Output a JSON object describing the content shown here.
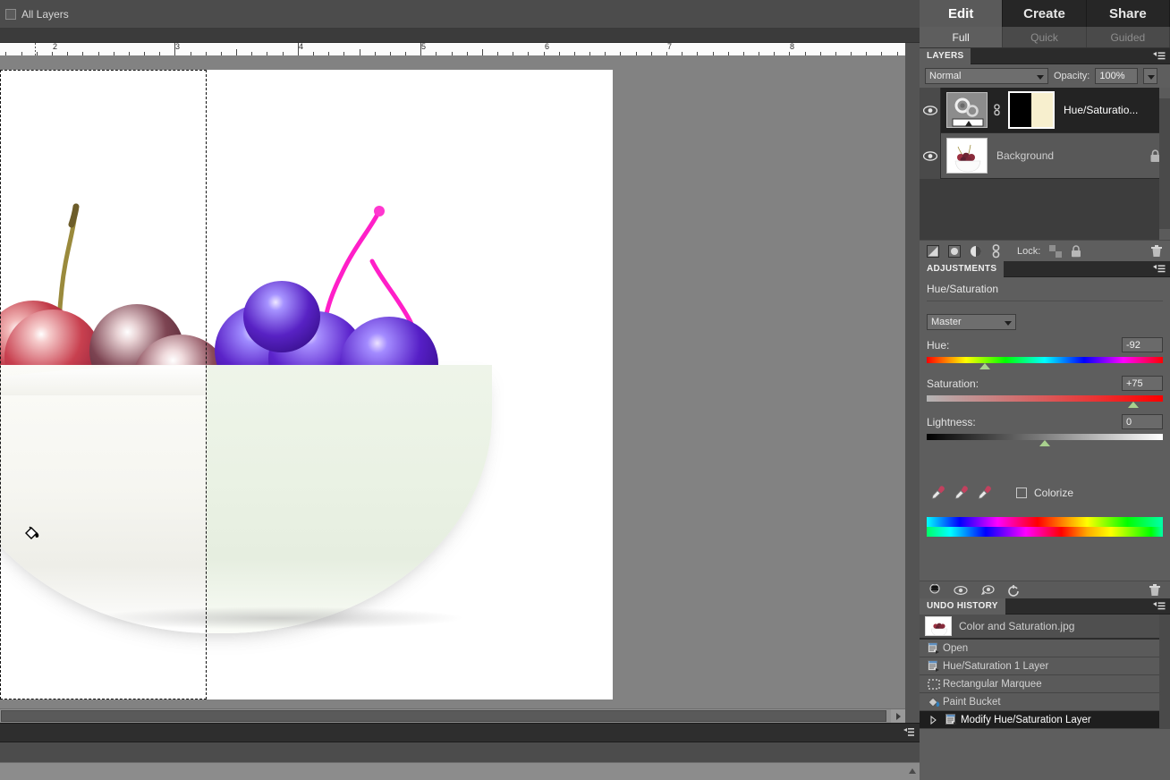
{
  "options_bar": {
    "all_layers_label": "All Layers",
    "all_layers_checked": false
  },
  "ruler": {
    "unit_marks": [
      "2",
      "3",
      "4",
      "5",
      "6",
      "7",
      "8"
    ]
  },
  "canvas": {
    "cursor_icon": "paint-bucket-cursor",
    "selection": "rectangular-marquee",
    "description_left": "original red cherries in white bowl",
    "description_right": "hue-shifted purple cherries"
  },
  "right_panel": {
    "main_tabs": [
      {
        "label": "Edit",
        "active": true
      },
      {
        "label": "Create",
        "active": false
      },
      {
        "label": "Share",
        "active": false
      }
    ],
    "sub_tabs": [
      {
        "label": "Full",
        "active": true
      },
      {
        "label": "Quick",
        "active": false
      },
      {
        "label": "Guided",
        "active": false
      }
    ]
  },
  "layers_panel": {
    "title": "LAYERS",
    "blend_mode": "Normal",
    "opacity_label": "Opacity:",
    "opacity_value": "100%",
    "lock_label": "Lock:",
    "layers": [
      {
        "name": "Hue/Saturatio...",
        "visible": true,
        "selected": true,
        "type": "adjustment",
        "has_mask": true,
        "locked": false
      },
      {
        "name": "Background",
        "visible": true,
        "selected": false,
        "type": "image",
        "has_mask": false,
        "locked": true
      }
    ]
  },
  "adjustments_panel": {
    "title": "ADJUSTMENTS",
    "adjustment_name": "Hue/Saturation",
    "channel": "Master",
    "sliders": [
      {
        "label": "Hue:",
        "value": "-92",
        "min": -180,
        "max": 180,
        "numeric": -92
      },
      {
        "label": "Saturation:",
        "value": "+75",
        "min": -100,
        "max": 100,
        "numeric": 75
      },
      {
        "label": "Lightness:",
        "value": "0",
        "min": -100,
        "max": 100,
        "numeric": 0
      }
    ],
    "colorize_label": "Colorize",
    "colorize_checked": false,
    "eyedroppers": [
      "eyedropper-icon",
      "eyedropper-add-icon",
      "eyedropper-subtract-icon"
    ]
  },
  "history_panel": {
    "title": "UNDO HISTORY",
    "snapshot": "Color and Saturation.jpg",
    "states": [
      {
        "label": "Open",
        "icon": "document-icon",
        "active": false
      },
      {
        "label": "Hue/Saturation 1 Layer",
        "icon": "document-icon",
        "active": false
      },
      {
        "label": "Rectangular Marquee",
        "icon": "marquee-icon",
        "active": false
      },
      {
        "label": "Paint Bucket",
        "icon": "paint-bucket-icon",
        "active": false
      },
      {
        "label": "Modify Hue/Saturation Layer",
        "icon": "document-icon",
        "active": true
      }
    ]
  },
  "colors": {
    "panel_bg": "#5e5e5e",
    "dark_bg": "#2b2b2b",
    "accent_selected": "#1e1e1e",
    "knob": "#a9d18e"
  }
}
